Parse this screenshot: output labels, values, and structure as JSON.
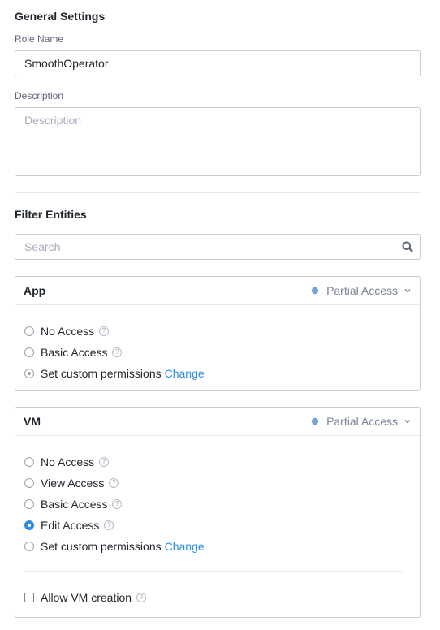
{
  "general": {
    "title": "General Settings",
    "role_name_label": "Role Name",
    "role_name_value": "SmoothOperator",
    "description_label": "Description",
    "description_placeholder": "Description"
  },
  "filter": {
    "title": "Filter Entities",
    "search_placeholder": "Search"
  },
  "panels": {
    "app": {
      "title": "App",
      "status": "Partial Access",
      "options": [
        {
          "label": "No Access",
          "selected": false
        },
        {
          "label": "Basic Access",
          "selected": false
        },
        {
          "label": "Set custom permissions",
          "selected": true,
          "link": "Change"
        }
      ]
    },
    "vm": {
      "title": "VM",
      "status": "Partial Access",
      "options": [
        {
          "label": "No Access",
          "selected": false
        },
        {
          "label": "View Access",
          "selected": false
        },
        {
          "label": "Basic Access",
          "selected": false
        },
        {
          "label": "Edit Access",
          "selected": true
        },
        {
          "label": "Set custom permissions",
          "selected": false,
          "link": "Change"
        }
      ],
      "allow_creation_label": "Allow VM creation",
      "allow_creation_checked": false
    }
  },
  "help_glyph": "?",
  "colors": {
    "accent": "#2c8ce4",
    "status_dot": "#74a6dc"
  }
}
